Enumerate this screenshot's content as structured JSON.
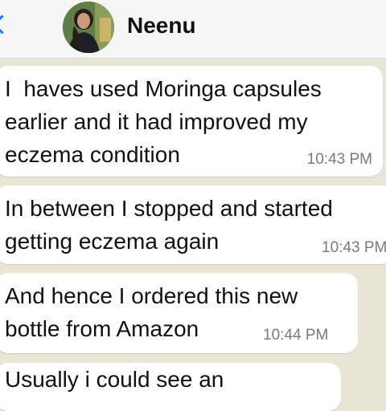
{
  "header": {
    "contact_name": "Neenu"
  },
  "messages": [
    {
      "text": "I  haves used Moringa capsules\nearlier and it had improved my\neczema condition",
      "time": "10:43 PM"
    },
    {
      "text": "In between I stopped and started\ngetting eczema again",
      "time": "10:43 PM"
    },
    {
      "text": "And hence I ordered this new\nbottle from Amazon",
      "time": "10:44 PM"
    },
    {
      "text": "Usually i could see an",
      "time": ""
    }
  ],
  "colors": {
    "chat_bg": "#e9e6d6",
    "bubble": "#ffffff",
    "accent": "#1a7cf5"
  },
  "icons": [
    "chevron-left-icon"
  ]
}
